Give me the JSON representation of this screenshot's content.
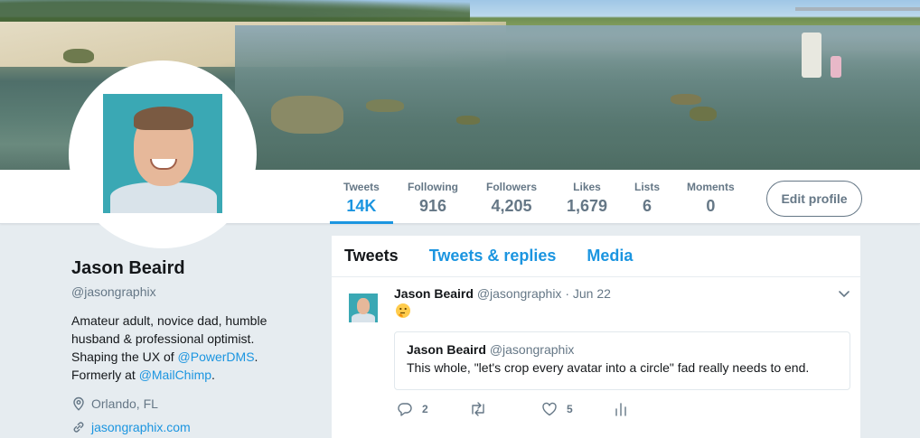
{
  "colors": {
    "accent": "#1b95e0",
    "muted": "#657786",
    "text": "#14171a",
    "page_bg": "#e6ecf0"
  },
  "nav": {
    "stats": [
      {
        "label": "Tweets",
        "value": "14K",
        "active": true
      },
      {
        "label": "Following",
        "value": "916"
      },
      {
        "label": "Followers",
        "value": "4,205"
      },
      {
        "label": "Likes",
        "value": "1,679"
      },
      {
        "label": "Lists",
        "value": "6"
      },
      {
        "label": "Moments",
        "value": "0"
      }
    ],
    "edit_profile_label": "Edit profile"
  },
  "profile": {
    "name": "Jason Beaird",
    "handle": "@jasongraphix",
    "bio": {
      "line1": "Amateur adult, novice dad, humble",
      "line2": "husband & professional optimist.",
      "line3_prefix": "Shaping the UX of ",
      "link1": "@PowerDMS",
      "line3_suffix": ".",
      "line4_prefix": "Formerly at ",
      "link2": "@MailChimp",
      "line4_suffix": "."
    },
    "location": "Orlando, FL",
    "website": "jasongraphix.com",
    "location_icon": "location-pin-icon",
    "link_icon": "link-icon"
  },
  "timeline": {
    "tabs": [
      {
        "label": "Tweets",
        "active": true
      },
      {
        "label": "Tweets & replies"
      },
      {
        "label": "Media"
      }
    ],
    "tweet": {
      "name": "Jason Beaird",
      "handle": "@jasongraphix",
      "date": "· Jun 22",
      "emoji_icon": "thinking-face-icon",
      "quote": {
        "name": "Jason Beaird",
        "handle": "@jasongraphix",
        "text": "This whole, \"let's crop every avatar into a circle\" fad really needs to end."
      },
      "actions": {
        "reply_count": "2",
        "retweet_count": "",
        "like_count": "5"
      }
    }
  }
}
